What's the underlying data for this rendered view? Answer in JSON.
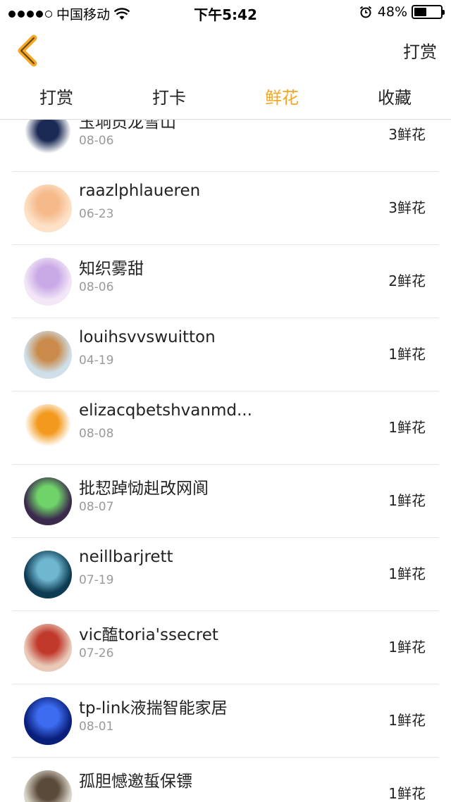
{
  "status_bar": {
    "carrier": "中国移动",
    "time": "下午5:42",
    "battery": "48%",
    "battery_level": 0.48
  },
  "nav": {
    "action_label": "打赏"
  },
  "tabs": [
    {
      "label": "打赏"
    },
    {
      "label": "打卡"
    },
    {
      "label": "鲜花",
      "active": true
    },
    {
      "label": "收藏"
    }
  ],
  "accent_color": "#f5a623",
  "records": [
    {
      "name": "玉垌员龙雪山",
      "date": "08-06",
      "count": "3鲜花",
      "avatar_colors": [
        "#ffffff",
        "#1b2a55"
      ]
    },
    {
      "name": "raazlphlaueren",
      "date": "06-23",
      "count": "3鲜花",
      "avatar_colors": [
        "#fde2c8",
        "#f5b98a"
      ]
    },
    {
      "name": "知织雾甜",
      "date": "08-06",
      "count": "2鲜花",
      "avatar_colors": [
        "#f2e6f7",
        "#c9a9e6"
      ]
    },
    {
      "name": "louihsvvswuitton",
      "date": "04-19",
      "count": "1鲜花",
      "avatar_colors": [
        "#cfe0ea",
        "#c98a4a"
      ]
    },
    {
      "name": "elizacqbetshvanmd...",
      "date": "08-08",
      "count": "1鲜花",
      "avatar_colors": [
        "#ffffff",
        "#f39a1e"
      ]
    },
    {
      "name": "批恝踔恸赳改网阆",
      "date": "08-07",
      "count": "1鲜花",
      "avatar_colors": [
        "#3c2a4d",
        "#6fd36a"
      ]
    },
    {
      "name": "neillbarjrett",
      "date": "07-19",
      "count": "1鲜花",
      "avatar_colors": [
        "#0d3b52",
        "#6fb6cf"
      ]
    },
    {
      "name": "vic醢toria'ssecret",
      "date": "07-26",
      "count": "1鲜花",
      "avatar_colors": [
        "#e9c9b8",
        "#c0392b"
      ]
    },
    {
      "name": "tp-link液揣智能家居",
      "date": "08-01",
      "count": "1鲜花",
      "avatar_colors": [
        "#0a1f7a",
        "#3d6cf0"
      ]
    },
    {
      "name": "孤胆憾邀蜇保镖",
      "date": "",
      "count": "1鲜花",
      "avatar_colors": [
        "#d9d4c8",
        "#5a4a3a"
      ]
    }
  ]
}
